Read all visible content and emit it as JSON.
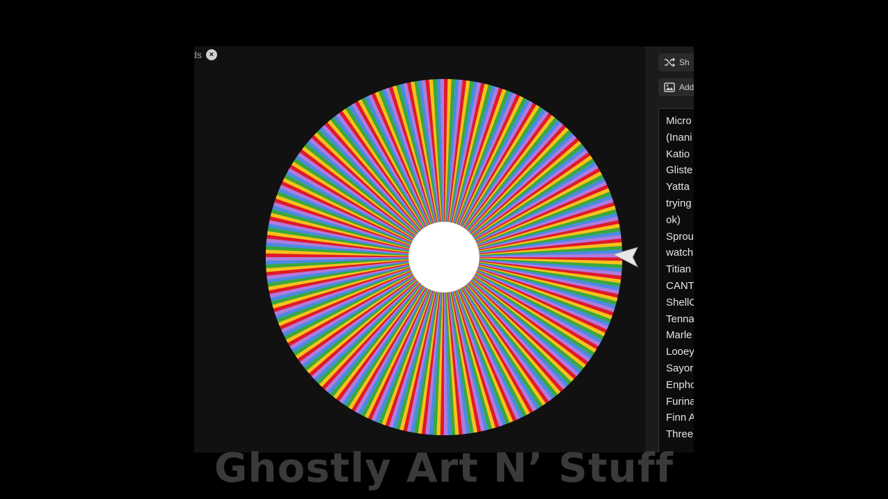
{
  "wheel_pane": {
    "top_label": "ds",
    "close_icon": "close-icon",
    "wheel_segment_colors": [
      "#e01a2a",
      "#f7c21a",
      "#3aa83e",
      "#4a8be0",
      "#b07be0"
    ],
    "pointer_icon": "pointer-arrow-icon"
  },
  "sidebar": {
    "shuffle_button": {
      "label": "Sh",
      "icon": "shuffle-icon"
    },
    "add_image_button": {
      "label": "Add",
      "icon": "image-icon"
    },
    "entries": [
      "Micro",
      "(Inani",
      "Katio",
      "Gliste",
      "Yatta",
      "trying",
      "ok)",
      "Sprou",
      "watch",
      "Titian",
      "CANT",
      "ShellC",
      "Tenna",
      "Marle",
      "Looey",
      "Sayor",
      "Enpho",
      "Furina",
      "Finn A",
      "Three"
    ]
  },
  "watermark": "Ghostly Art N’ Stuff"
}
